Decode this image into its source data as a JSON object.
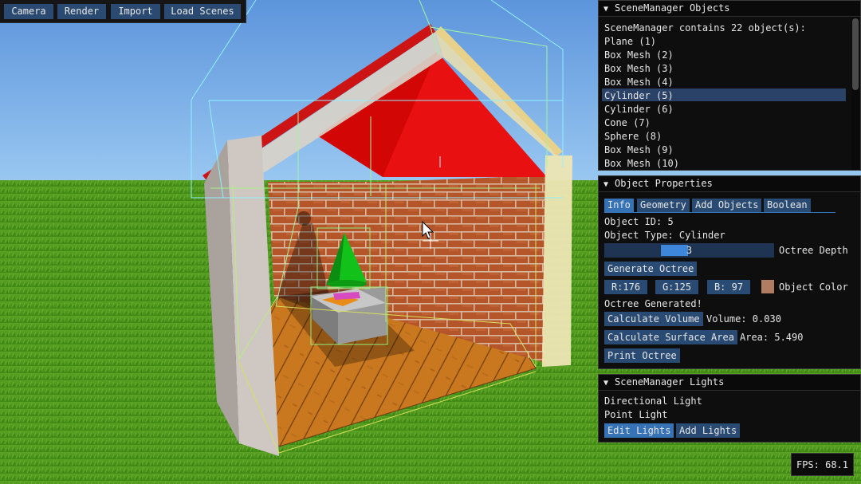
{
  "toolbar": {
    "buttons": [
      "Camera",
      "Render",
      "Import",
      "Load Scenes"
    ]
  },
  "objects_panel": {
    "title": "SceneManager Objects",
    "summary": "SceneManager contains 22 object(s):",
    "items": [
      "Plane (1)",
      "Box Mesh (2)",
      "Box Mesh (3)",
      "Box Mesh (4)",
      "Cylinder (5)",
      "Cylinder (6)",
      "Cone (7)",
      "Sphere (8)",
      "Box Mesh (9)",
      "Box Mesh (10)"
    ],
    "selected_item": "Cylinder (5)"
  },
  "properties_panel": {
    "title": "Object Properties",
    "tabs": [
      "Info",
      "Geometry",
      "Add Objects",
      "Boolean"
    ],
    "active_tab": "Info",
    "object_id": "Object ID: 5",
    "object_type": "Object Type: Cylinder",
    "octree_depth_value": "3",
    "octree_depth_label": "Octree Depth",
    "generate_octree": "Generate Octree",
    "color_r": "R:176",
    "color_g": "G:125",
    "color_b": "B: 97",
    "color_swatch": "#b07d61",
    "object_color_label": "Object Color",
    "octree_status": "Octree Generated!",
    "calc_volume": "Calculate Volume",
    "volume": "Volume: 0.030",
    "calc_area": "Calculate Surface Area",
    "area": "Area: 5.490",
    "print_octree": "Print Octree"
  },
  "lights_panel": {
    "title": "SceneManager Lights",
    "items": [
      "Directional Light",
      "Point Light"
    ],
    "edit_lights": "Edit Lights",
    "add_lights": "Add Lights"
  },
  "fps": "FPS: 68.1"
}
